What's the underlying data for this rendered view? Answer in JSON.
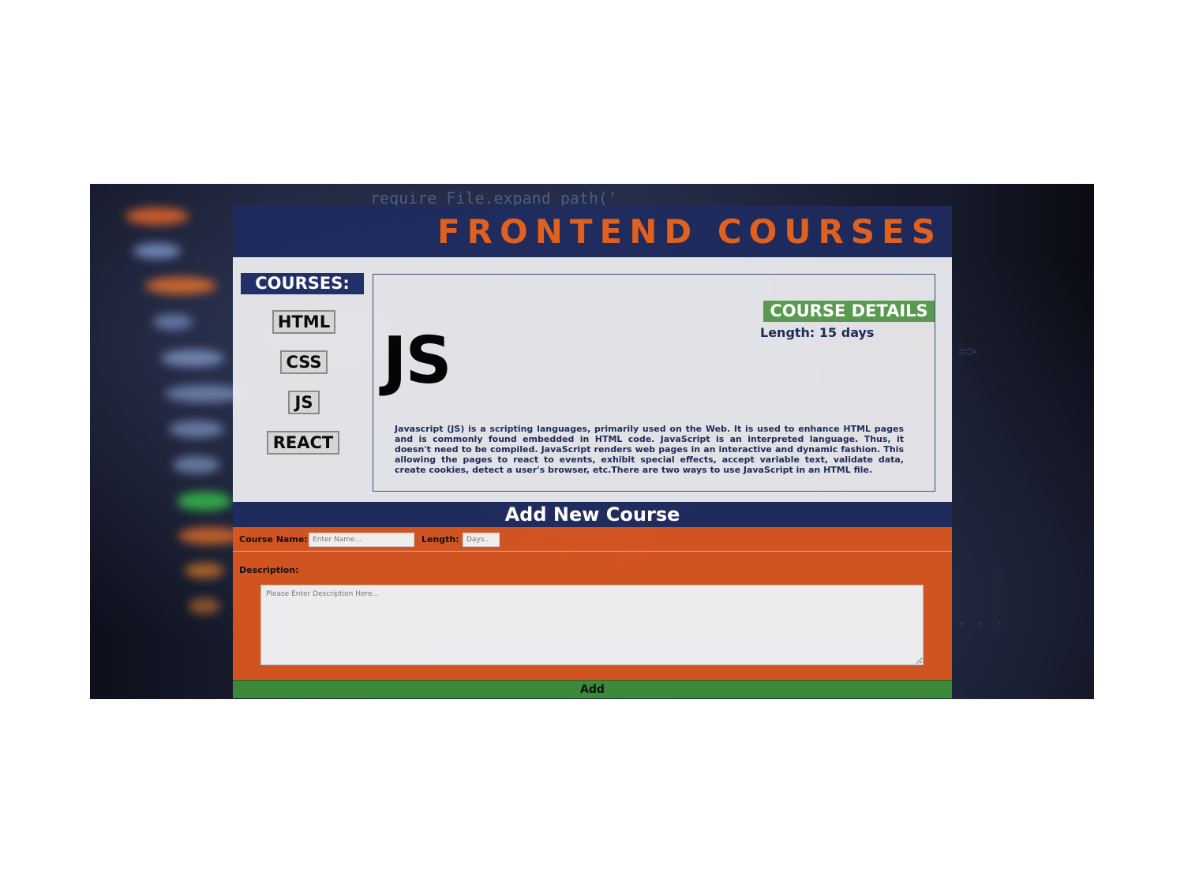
{
  "header": {
    "title": "FRONTEND COURSES"
  },
  "sidebar": {
    "title": "COURSES:",
    "items": [
      {
        "label": "HTML"
      },
      {
        "label": "CSS"
      },
      {
        "label": "JS"
      },
      {
        "label": "REACT"
      }
    ]
  },
  "detail": {
    "course_code": "JS",
    "badge": "COURSE DETAILS",
    "length": "Length: 15 days",
    "description": "Javascript (JS) is a scripting languages, primarily used on the Web. It is used to enhance HTML pages and is commonly found embedded in HTML code. JavaScript is an interpreted language. Thus, it doesn't need to be compiled. JavaScript renders web pages in an interactive and dynamic fashion. This allowing the pages to react to events, exhibit special effects, accept variable text, validate data, create cookies, detect a user's browser, etc.There are two ways to use JavaScript in an HTML file."
  },
  "form": {
    "section_title": "Add New Course",
    "course_name_label": "Course Name:",
    "course_name_placeholder": "Enter Name...",
    "length_label": "Length:",
    "length_placeholder": "Days..",
    "description_label": "Description:",
    "description_placeholder": "Please Enter Description Here...",
    "submit_label": "Add"
  },
  "colors": {
    "navy": "#202b60",
    "orange": "#e0601e",
    "green": "#3b8a3a",
    "badge_green": "#5a9a50"
  }
}
